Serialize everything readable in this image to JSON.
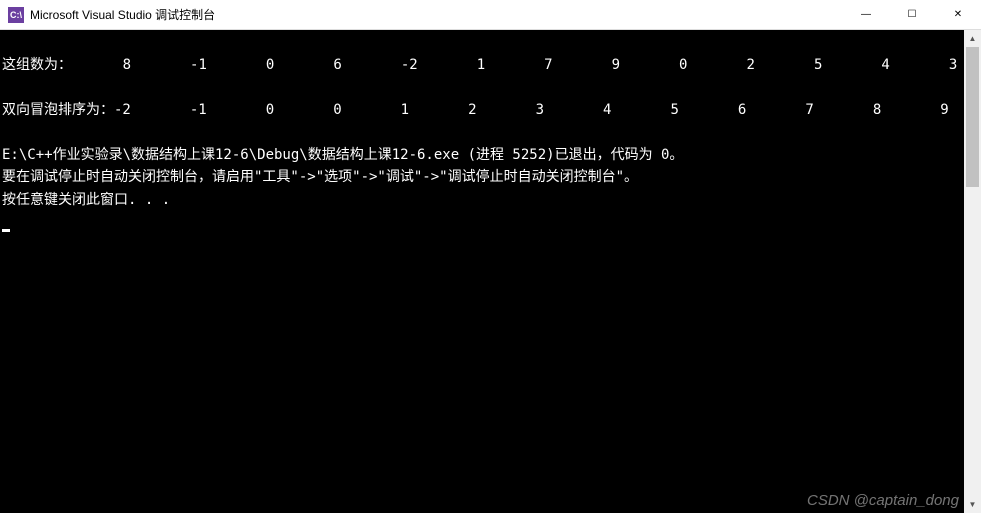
{
  "titlebar": {
    "icon_label": "C:\\",
    "title": "Microsoft Visual Studio 调试控制台"
  },
  "window_controls": {
    "minimize": "—",
    "maximize": "☐",
    "close": "✕"
  },
  "console": {
    "row1_label": "这组数为：",
    "row1_values": [
      "8",
      "-1",
      "0",
      "6",
      "-2",
      "1",
      "7",
      "9",
      "0",
      "2",
      "5",
      "4",
      "3"
    ],
    "row2_label": "双向冒泡排序为：",
    "row2_values": [
      "-2",
      "-1",
      "0",
      "0",
      "1",
      "2",
      "3",
      "4",
      "5",
      "6",
      "7",
      "8",
      "9"
    ],
    "exit_line": "E:\\C++作业实验录\\数据结构上课12-6\\Debug\\数据结构上课12-6.exe (进程 5252)已退出，代码为 0。",
    "hint_line": "要在调试停止时自动关闭控制台，请启用\"工具\"->\"选项\"->\"调试\"->\"调试停止时自动关闭控制台\"。",
    "press_key_line": "按任意键关闭此窗口. . ."
  },
  "scrollbar": {
    "up": "▲",
    "down": "▼"
  },
  "watermark": "CSDN @captain_dong"
}
